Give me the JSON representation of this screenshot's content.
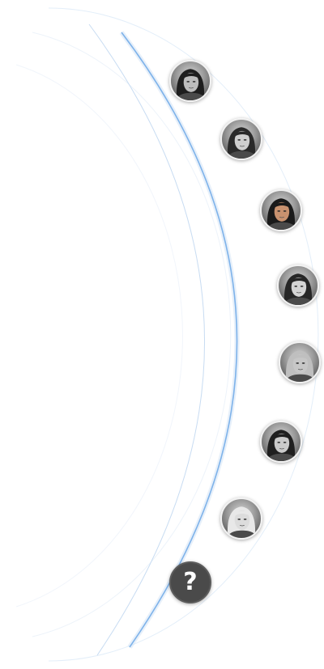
{
  "characters": [
    {
      "id": "char-1",
      "portrait": "dark-haired-male-portrait",
      "hair": "#1e1e1e",
      "skin": "#bdbdbd"
    },
    {
      "id": "char-2",
      "portrait": "dark-haired-female-portrait",
      "hair": "#2a2a2a",
      "skin": "#cfcfcf"
    },
    {
      "id": "char-3",
      "portrait": "colored-male-warrior-portrait",
      "hair": "#1a1a1a",
      "skin": "#c9926f"
    },
    {
      "id": "char-4",
      "portrait": "female-with-earring-portrait",
      "hair": "#262626",
      "skin": "#d4d4d4"
    },
    {
      "id": "char-5",
      "portrait": "white-haired-monk-portrait",
      "hair": "#bfbfbf",
      "skin": "#c7c7c7"
    },
    {
      "id": "char-6",
      "portrait": "dark-haired-female-warrior-portrait",
      "hair": "#1f1f1f",
      "skin": "#cacaca"
    },
    {
      "id": "char-7",
      "portrait": "white-haired-female-portrait",
      "hair": "#e8e8e8",
      "skin": "#dcdcdc"
    }
  ],
  "locked": {
    "id": "char-locked",
    "glyph": "?",
    "icon": "question-mark-icon",
    "background": "#4a4a4a"
  },
  "colors": {
    "arc_main": "#7fb3ea",
    "arc_faint": "#d6e6f7",
    "avatar_border": "#f2f2f2"
  }
}
